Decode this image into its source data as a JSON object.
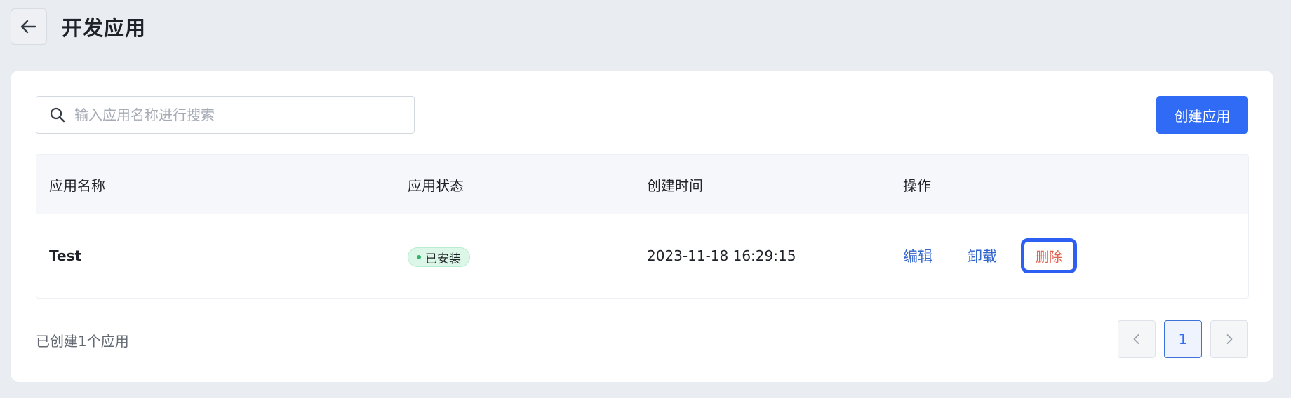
{
  "header": {
    "title": "开发应用",
    "back_icon": "arrow-left-icon"
  },
  "search": {
    "placeholder": "输入应用名称进行搜索",
    "value": "",
    "icon": "search-icon"
  },
  "toolbar": {
    "create_label": "创建应用"
  },
  "table": {
    "columns": [
      "应用名称",
      "应用状态",
      "创建时间",
      "操作"
    ],
    "rows": [
      {
        "name": "Test",
        "status": "已安装",
        "created_at": "2023-11-18 16:29:15",
        "actions": {
          "edit": "编辑",
          "uninstall": "卸载",
          "delete": "删除"
        }
      }
    ]
  },
  "footer": {
    "count_text": "已创建1个应用"
  },
  "pagination": {
    "current_page": "1",
    "prev_icon": "chevron-left-icon",
    "next_icon": "chevron-right-icon"
  },
  "colors": {
    "primary": "#2f6bf5",
    "link": "#3366cc",
    "danger": "#e0624f",
    "status_green": "#2fb86c",
    "highlight_border": "#2c5ff2"
  }
}
